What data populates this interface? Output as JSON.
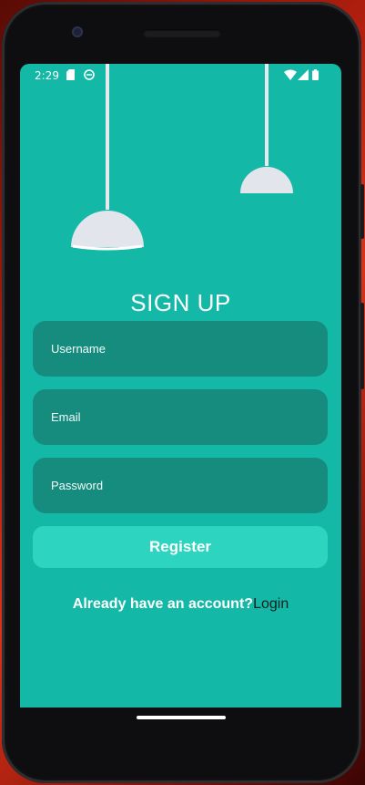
{
  "status_bar": {
    "time": "2:29",
    "left_icons": [
      "sd-card-icon",
      "app-notification-icon"
    ],
    "right_icons": [
      "wifi-icon",
      "signal-icon",
      "battery-icon"
    ]
  },
  "signup": {
    "title": "SIGN UP",
    "username_placeholder": "Username",
    "email_placeholder": "Email",
    "password_placeholder": "Password",
    "register_label": "Register",
    "already_text": "Already have an account?",
    "login_link": "Login"
  },
  "colors": {
    "background": "#14b8a6",
    "field": "#168c7e",
    "button": "#2dd4bf",
    "lamp": "#e2e6ec"
  }
}
